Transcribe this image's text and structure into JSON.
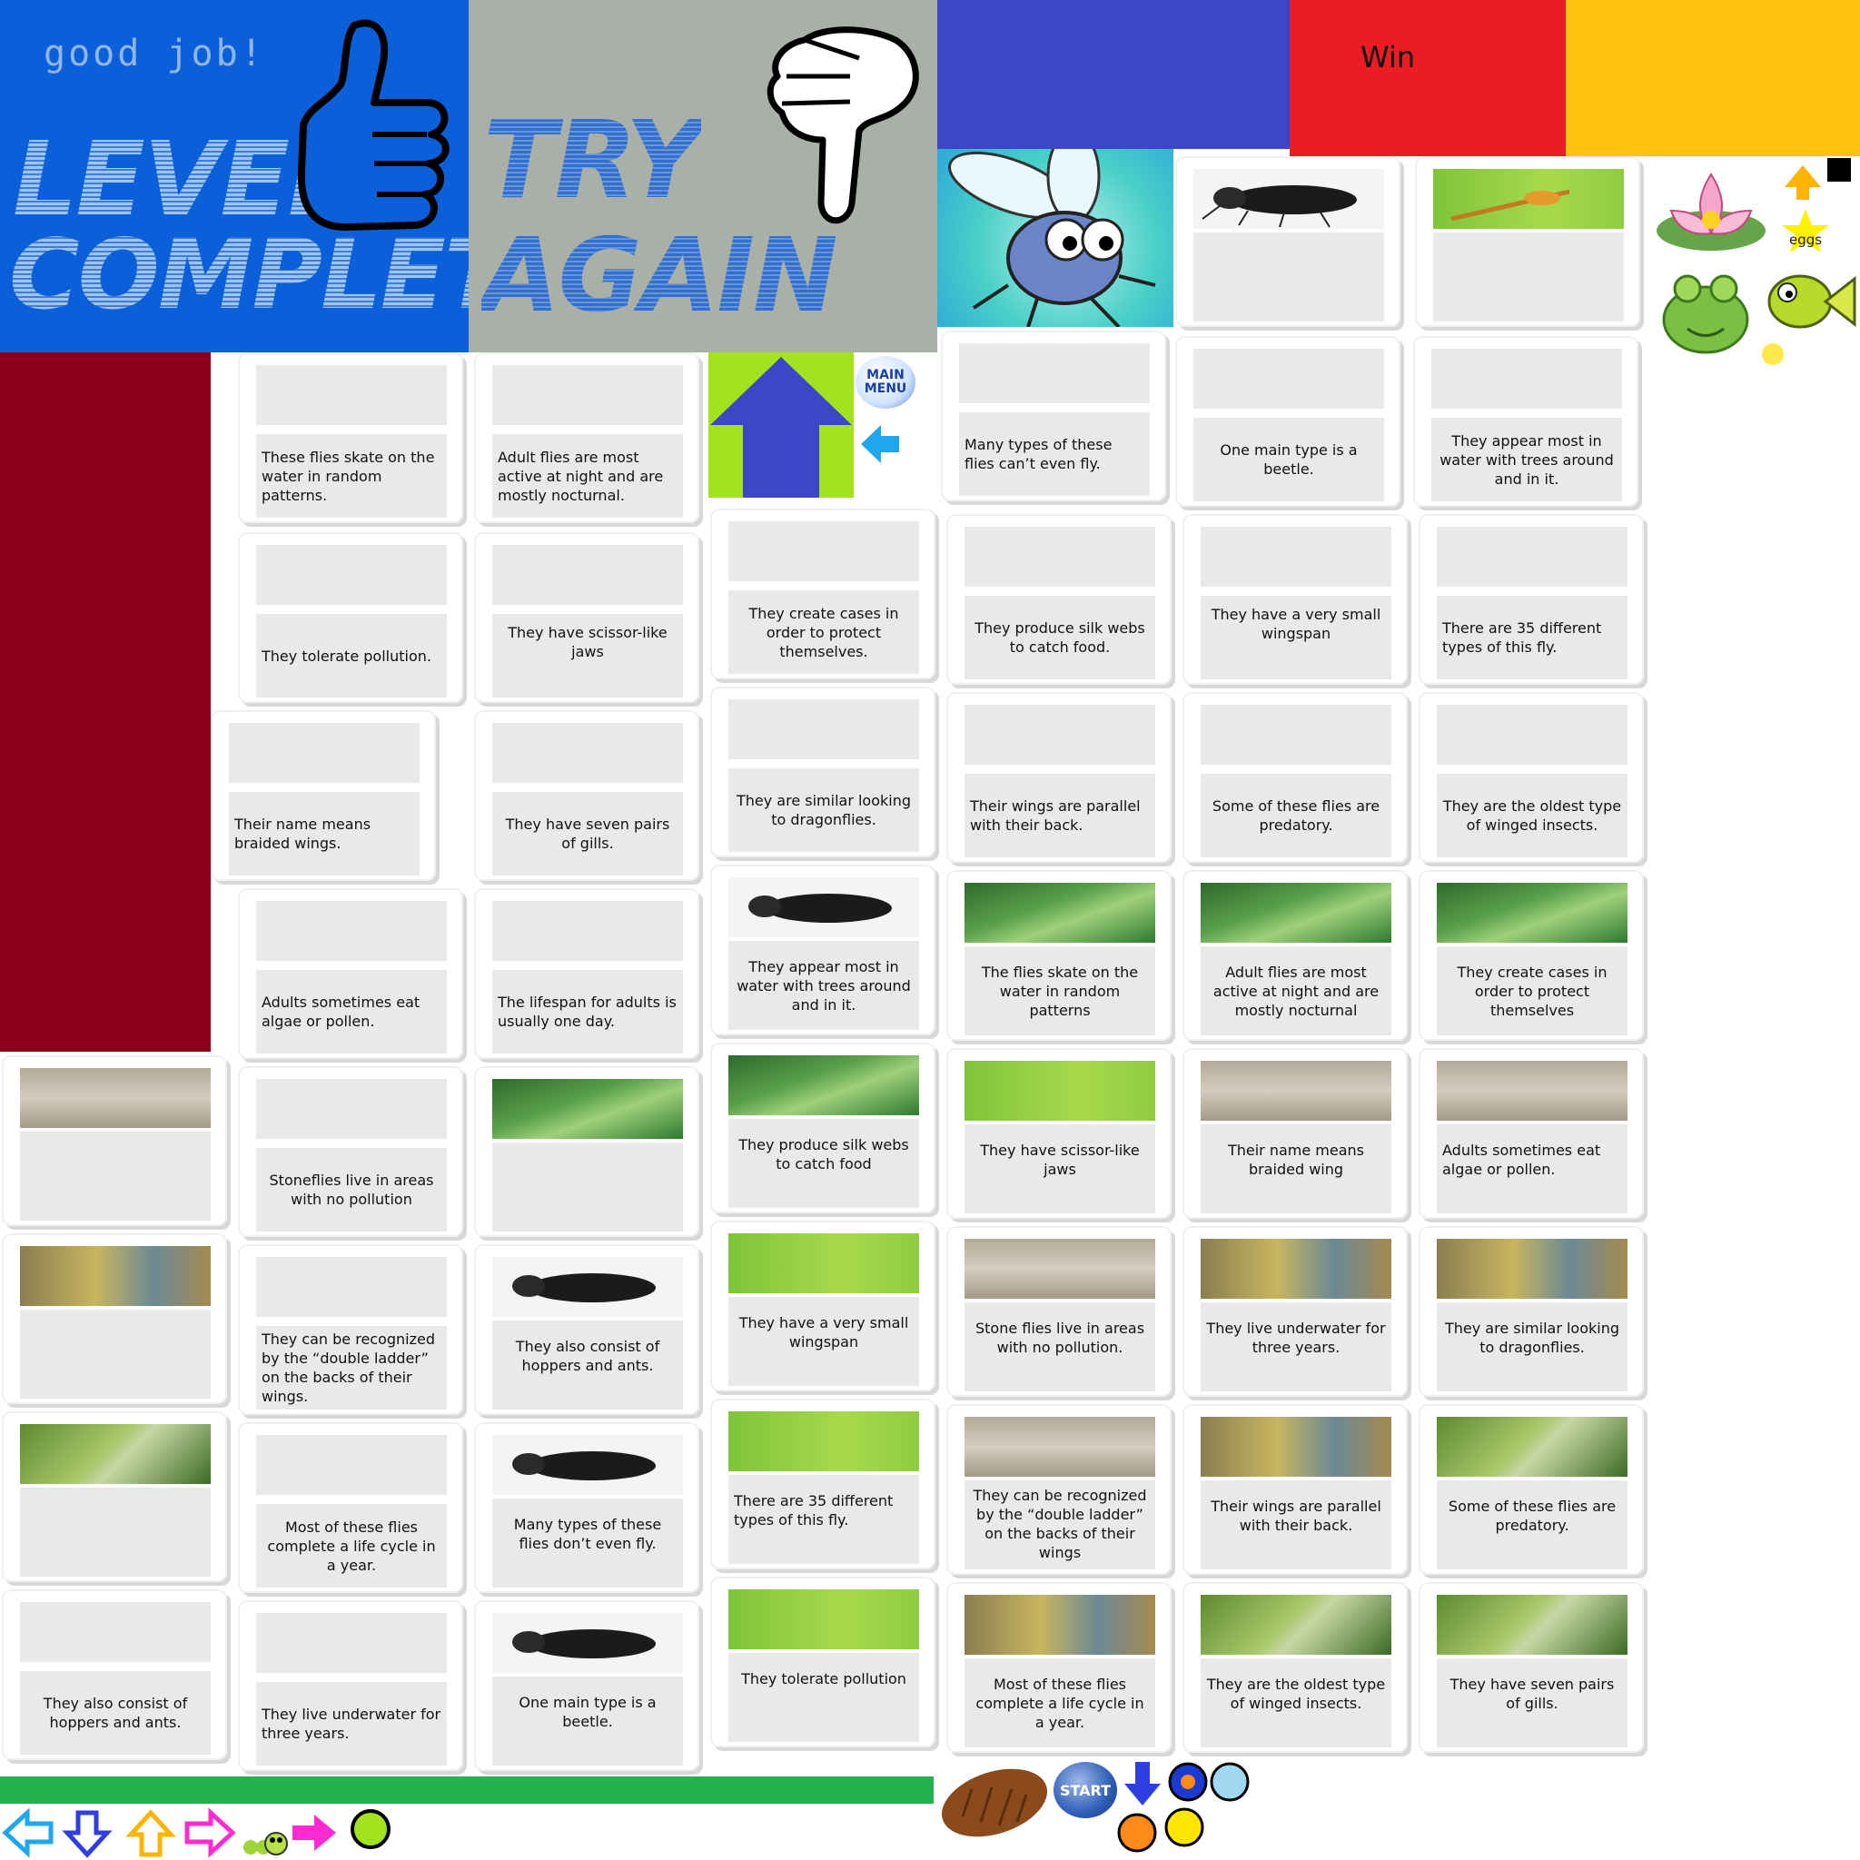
{
  "header": {
    "good_job": "good job!",
    "level_complete_1": "LEVEL",
    "level_complete_2": "COMPLETE",
    "try_again_1": "TRY",
    "try_again_2": "AGAIN",
    "win": "Win",
    "main_menu": "MAIN MENU",
    "eggs": "eggs",
    "start": "START"
  },
  "colors": {
    "blue_panel": "#0b5fd8",
    "gray_panel": "#a9b0a8",
    "purple_bar": "#3e46c8",
    "red_bar": "#ec1c24",
    "yellow_bar": "#ffc20e",
    "maroon": "#8a0018",
    "green_bar": "#22b14c"
  },
  "cards": [
    {
      "text": "These flies skate on the water in random patterns."
    },
    {
      "text": "Adult flies are most active at night and are mostly nocturnal."
    },
    {
      "text": "Many types of these flies can’t even fly."
    },
    {
      "text": "One main type is a beetle."
    },
    {
      "text": "They appear most in water with trees around and in it."
    },
    {
      "text": "They tolerate pollution."
    },
    {
      "text": "They have scissor-like jaws"
    },
    {
      "text": "They create cases in order to protect themselves."
    },
    {
      "text": "They produce silk webs to catch food."
    },
    {
      "text": "They have a very small wingspan"
    },
    {
      "text": "There are 35 different types of this fly."
    },
    {
      "text": "Their name means braided wings."
    },
    {
      "text": "They have seven pairs of gills."
    },
    {
      "text": "They are similar looking to dragonflies."
    },
    {
      "text": "Their wings are parallel with their back."
    },
    {
      "text": "Some of these flies are predatory."
    },
    {
      "text": "They are the oldest type of winged insects."
    },
    {
      "text": "Adults sometimes eat algae or pollen."
    },
    {
      "text": "The lifespan for adults is usually one day."
    },
    {
      "text": "They appear most in water with trees around and in it."
    },
    {
      "text": "The flies skate on the water in random patterns"
    },
    {
      "text": "Adult flies are most active at night and are mostly nocturnal"
    },
    {
      "text": "They create cases in order to protect themselves"
    },
    {
      "text": "Stoneflies live in areas with no pollution"
    },
    {
      "text": "They produce silk webs to catch food"
    },
    {
      "text": "They have scissor-like jaws"
    },
    {
      "text": "Their name means braided wing"
    },
    {
      "text": "Adults sometimes eat algae or pollen."
    },
    {
      "text": "They can be recognized by the “double ladder” on the backs of their wings."
    },
    {
      "text": "They also consist of hoppers and ants."
    },
    {
      "text": "They have a very small wingspan"
    },
    {
      "text": "Stone flies live in areas with no pollution."
    },
    {
      "text": "They live underwater for three years."
    },
    {
      "text": "They are similar looking to dragonflies."
    },
    {
      "text": "Most of these flies complete a life cycle in a year."
    },
    {
      "text": "Many types of these flies don’t even fly."
    },
    {
      "text": "There are 35 different types of this fly."
    },
    {
      "text": "They can be recognized by the “double ladder” on the backs of their wings"
    },
    {
      "text": "Their wings are parallel with their back."
    },
    {
      "text": "Some of these flies are predatory."
    },
    {
      "text": "They also consist of hoppers and ants."
    },
    {
      "text": "They live underwater for three years."
    },
    {
      "text": "One main type is a beetle."
    },
    {
      "text": "They tolerate pollution"
    },
    {
      "text": "Most of these flies complete a life cycle in a year."
    },
    {
      "text": "They are the oldest type of winged insects."
    },
    {
      "text": "They have seven pairs of gills."
    }
  ],
  "icons": [
    "thumbs-up-icon",
    "thumbs-down-icon",
    "fly-icon",
    "lily-icon",
    "frog-icon",
    "fish-icon",
    "star-icon",
    "arrow-icons",
    "caterpillar-icon",
    "cocoon-icon"
  ]
}
